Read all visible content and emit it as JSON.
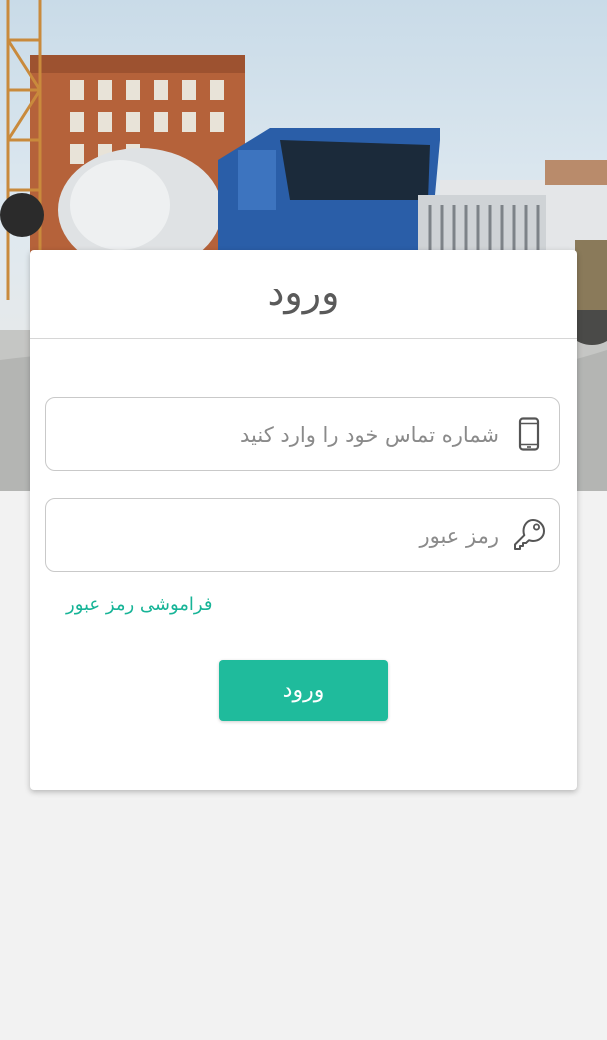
{
  "hero": {
    "image_description_icon": "concrete-mixer-truck-photo"
  },
  "login": {
    "title": "ورود",
    "phone_placeholder": "شماره تماس خود را وارد کنید",
    "phone_value": "",
    "phone_icon": "mobile-phone-icon",
    "password_placeholder": "رمز عبور",
    "password_value": "",
    "password_icon": "key-icon",
    "forgot_label": "فراموشی رمز عبور",
    "submit_label": "ورود"
  },
  "colors": {
    "accent": "#1fbb9c",
    "link": "#17b497",
    "background": "#f2f2f2",
    "card": "#ffffff"
  }
}
